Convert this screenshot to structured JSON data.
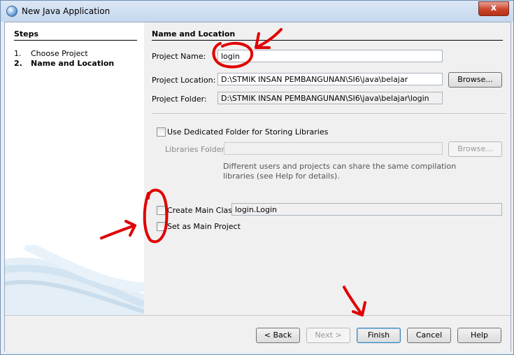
{
  "window": {
    "title": "New Java Application",
    "close_label": "x"
  },
  "steps": {
    "title": "Steps",
    "items": [
      {
        "number": "1.",
        "label": "Choose Project",
        "current": false
      },
      {
        "number": "2.",
        "label": "Name and Location",
        "current": true
      }
    ]
  },
  "panel": {
    "section_title": "Name and Location",
    "project_name_label": "Project Name:",
    "project_name_value": "login",
    "project_location_label": "Project Location:",
    "project_location_value": "D:\\STMIK INSAN PEMBANGUNAN\\SI6\\java\\belajar",
    "project_folder_label": "Project Folder:",
    "project_folder_value": "D:\\STMIK INSAN PEMBANGUNAN\\SI6\\java\\belajar\\login",
    "browse_label": "Browse...",
    "dedicated_folder_label": "Use Dedicated Folder for Storing Libraries",
    "libraries_folder_label": "Libraries Folder:",
    "libraries_folder_value": "",
    "browse_disabled_label": "Browse...",
    "description_line1": "Different users and projects can share the same compilation",
    "description_line2": "libraries (see Help for details).",
    "create_main_class_label": "Create Main Class",
    "main_class_value": "login.Login",
    "set_main_project_label": "Set as Main Project"
  },
  "footer": {
    "back_label": "< Back",
    "next_label": "Next >",
    "finish_label": "Finish",
    "cancel_label": "Cancel",
    "help_label": "Help"
  },
  "colors": {
    "annotation_red": "#e00000",
    "panel_bg": "#f0f0f0",
    "title_bar": "#c5d8ee"
  }
}
